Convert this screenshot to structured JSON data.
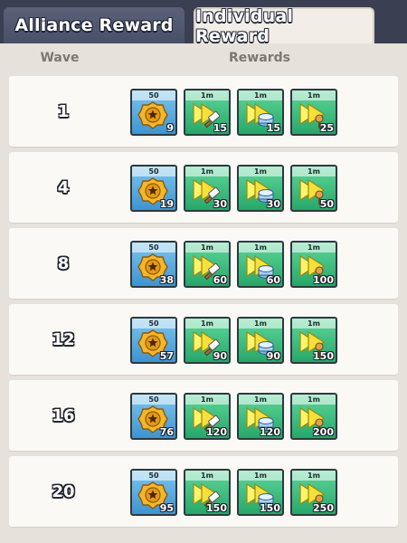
{
  "tabs": [
    {
      "label": "Alliance Reward",
      "active": false
    },
    {
      "label": "Individual Reward",
      "active": true
    }
  ],
  "headers": {
    "wave": "Wave",
    "rewards": "Rewards"
  },
  "colors": {
    "badge_bg": "#3e95d1",
    "speedup_bg": "#26a86a",
    "tab_bar": "#3a3f52"
  },
  "rows": [
    {
      "wave": "1",
      "rewards": [
        {
          "icon": "gold-badge-icon",
          "top": "50",
          "qty": "9"
        },
        {
          "icon": "speedup-hammer-icon",
          "top": "1m",
          "qty": "15"
        },
        {
          "icon": "speedup-training-icon",
          "top": "1m",
          "qty": "15"
        },
        {
          "icon": "speedup-research-icon",
          "top": "1m",
          "qty": "25"
        }
      ]
    },
    {
      "wave": "4",
      "rewards": [
        {
          "icon": "gold-badge-icon",
          "top": "50",
          "qty": "19"
        },
        {
          "icon": "speedup-hammer-icon",
          "top": "1m",
          "qty": "30"
        },
        {
          "icon": "speedup-training-icon",
          "top": "1m",
          "qty": "30"
        },
        {
          "icon": "speedup-research-icon",
          "top": "1m",
          "qty": "50"
        }
      ]
    },
    {
      "wave": "8",
      "rewards": [
        {
          "icon": "gold-badge-icon",
          "top": "50",
          "qty": "38"
        },
        {
          "icon": "speedup-hammer-icon",
          "top": "1m",
          "qty": "60"
        },
        {
          "icon": "speedup-training-icon",
          "top": "1m",
          "qty": "60"
        },
        {
          "icon": "speedup-research-icon",
          "top": "1m",
          "qty": "100"
        }
      ]
    },
    {
      "wave": "12",
      "rewards": [
        {
          "icon": "gold-badge-icon",
          "top": "50",
          "qty": "57"
        },
        {
          "icon": "speedup-hammer-icon",
          "top": "1m",
          "qty": "90"
        },
        {
          "icon": "speedup-training-icon",
          "top": "1m",
          "qty": "90"
        },
        {
          "icon": "speedup-research-icon",
          "top": "1m",
          "qty": "150"
        }
      ]
    },
    {
      "wave": "16",
      "rewards": [
        {
          "icon": "gold-badge-icon",
          "top": "50",
          "qty": "76"
        },
        {
          "icon": "speedup-hammer-icon",
          "top": "1m",
          "qty": "120"
        },
        {
          "icon": "speedup-training-icon",
          "top": "1m",
          "qty": "120"
        },
        {
          "icon": "speedup-research-icon",
          "top": "1m",
          "qty": "200"
        }
      ]
    },
    {
      "wave": "20",
      "rewards": [
        {
          "icon": "gold-badge-icon",
          "top": "50",
          "qty": "95"
        },
        {
          "icon": "speedup-hammer-icon",
          "top": "1m",
          "qty": "150"
        },
        {
          "icon": "speedup-training-icon",
          "top": "1m",
          "qty": "150"
        },
        {
          "icon": "speedup-research-icon",
          "top": "1m",
          "qty": "250"
        }
      ]
    }
  ]
}
